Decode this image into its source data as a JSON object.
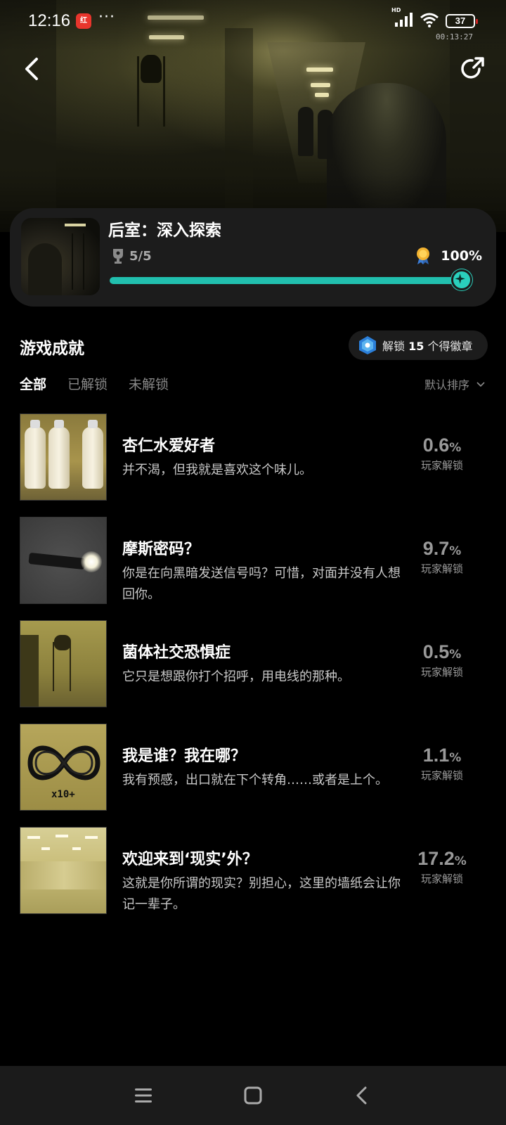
{
  "status_bar": {
    "time": "12:16",
    "app_badge": "红",
    "dots": "···",
    "network": "HD",
    "battery": "37",
    "timer": "00:13:27"
  },
  "game": {
    "title": "后室：深入探索",
    "trophies": "5/5",
    "completion": "100%",
    "progress": 1.0,
    "accent_color": "#21bfae"
  },
  "section": {
    "title": "游戏成就",
    "badge": {
      "prefix": "解锁",
      "count": "15",
      "suffix": "个得徽章"
    }
  },
  "tabs": [
    {
      "label": "全部",
      "active": true
    },
    {
      "label": "已解锁",
      "active": false
    },
    {
      "label": "未解锁",
      "active": false
    }
  ],
  "sort_label": "默认排序",
  "achievements": [
    {
      "name": "杏仁水爱好者",
      "desc": "并不渴，但我就是喜欢这个味儿。",
      "pct": "0.6",
      "unit": "%",
      "label": "玩家解锁",
      "thumb": "bottles"
    },
    {
      "name": "摩斯密码？",
      "desc": "你是在向黑暗发送信号吗？可惜，对面并没有人想回你。",
      "pct": "9.7",
      "unit": "%",
      "label": "玩家解锁",
      "thumb": "flashlight"
    },
    {
      "name": "菌体社交恐惧症",
      "desc": "它只是想跟你打个招呼，用电线的那种。",
      "pct": "0.5",
      "unit": "%",
      "label": "玩家解锁",
      "thumb": "creature"
    },
    {
      "name": "我是谁？我在哪？",
      "desc": "我有预感，出口就在下个转角……或者是上个。",
      "pct": "1.1",
      "unit": "%",
      "label": "玩家解锁",
      "thumb": "infinity",
      "thumb_text": "x10+"
    },
    {
      "name": "欢迎来到‘现实’外？",
      "desc": "这就是你所谓的现实？别担心，这里的墙纸会让你记一辈子。",
      "pct": "17.2",
      "unit": "%",
      "label": "玩家解锁",
      "thumb": "room"
    }
  ],
  "icons": {
    "back": "back-arrow-icon",
    "share": "share-icon",
    "trophy": "trophy-icon",
    "medal": "medal-icon",
    "badge": "hexagon-badge-icon",
    "sort": "chevron-down-icon",
    "nav": [
      "menu-icon",
      "home-icon",
      "back-icon"
    ]
  }
}
